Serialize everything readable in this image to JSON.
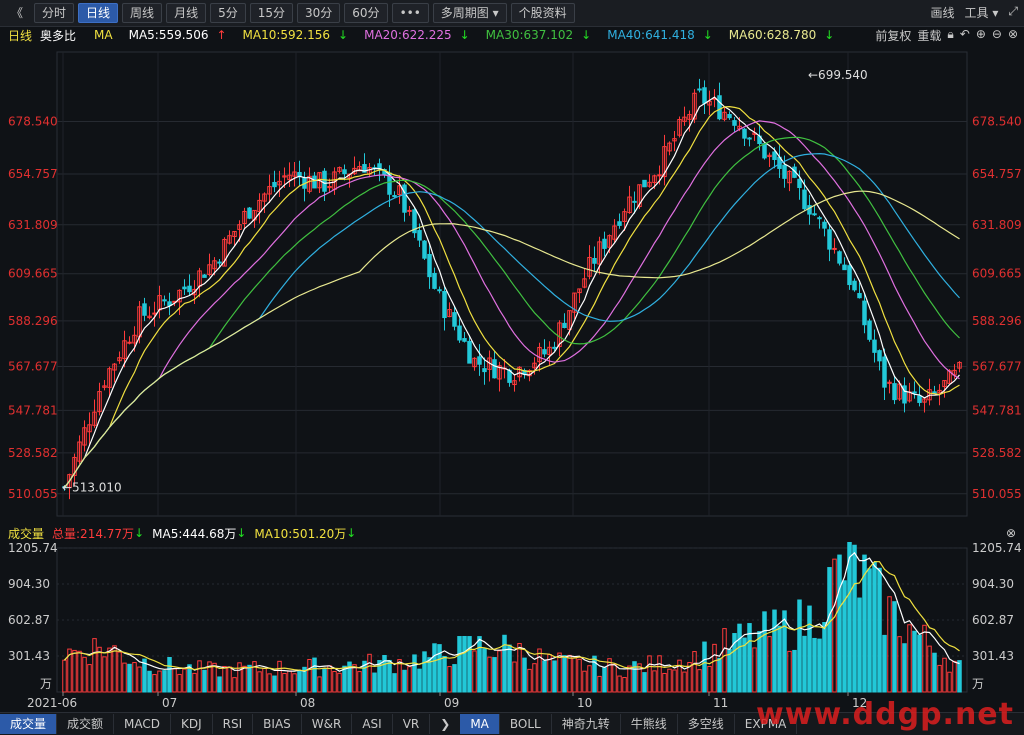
{
  "toolbar": {
    "back": "《",
    "periods": [
      "分时",
      "日线",
      "周线",
      "月线",
      "5分",
      "15分",
      "30分",
      "60分"
    ],
    "active": "日线",
    "more": "•••",
    "multi_period": "多周期图",
    "stock_info": "个股资料",
    "draw": "画线",
    "tools": "工具"
  },
  "info": {
    "period": "日线",
    "name": "奥多比",
    "ma_label": "MA",
    "ma": [
      {
        "label": "MA5:559.506",
        "arrow": "↑",
        "color": "#ffffff",
        "arrow_color": "#ff3b3b"
      },
      {
        "label": "MA10:592.156",
        "arrow": "↓",
        "color": "#f0e040",
        "arrow_color": "#22dd22"
      },
      {
        "label": "MA20:622.225",
        "arrow": "↓",
        "color": "#e070e0",
        "arrow_color": "#22dd22"
      },
      {
        "label": "MA30:637.102",
        "arrow": "↓",
        "color": "#40c040",
        "arrow_color": "#22dd22"
      },
      {
        "label": "MA40:641.418",
        "arrow": "↓",
        "color": "#30b0e0",
        "arrow_color": "#22dd22"
      },
      {
        "label": "MA60:628.780",
        "arrow": "↓",
        "color": "#e8e890",
        "arrow_color": "#22dd22"
      }
    ],
    "restore": "前复权",
    "overlay": "重载"
  },
  "price_axis": [
    "678.540",
    "654.757",
    "631.809",
    "609.665",
    "588.296",
    "567.677",
    "547.781",
    "528.582",
    "510.055"
  ],
  "price_range": [
    500,
    710
  ],
  "annotations": {
    "high": "699.540",
    "low": "513.010"
  },
  "volume": {
    "title": "成交量",
    "total": "总量:214.77万",
    "ma5": "MA5:444.68万",
    "ma10": "MA10:501.20万",
    "axis": [
      "1205.74",
      "904.30",
      "602.87",
      "301.43",
      "万"
    ]
  },
  "dates": [
    "2021-06",
    "07",
    "08",
    "09",
    "10",
    "11",
    "12"
  ],
  "tabs": [
    "成交量",
    "成交额",
    "MACD",
    "KDJ",
    "RSI",
    "BIAS",
    "W&R",
    "ASI",
    "VR",
    "MA",
    "BOLL",
    "神奇九转",
    "牛熊线",
    "多空线",
    "EXPMA"
  ],
  "active_tab": "MA",
  "watermark": "www.ddgp.net",
  "colors": {
    "up": "#ff3b3b",
    "down": "#22c8d8",
    "bg": "#0f1216"
  },
  "chart_data": {
    "type": "candlestick",
    "x": [
      "2021-06",
      "07",
      "08",
      "09",
      "10",
      "11",
      "12"
    ],
    "close_trend": [
      513,
      560,
      590,
      600,
      615,
      640,
      655,
      650,
      660,
      645,
      600,
      570,
      565,
      575,
      610,
      640,
      660,
      690,
      680,
      660,
      640,
      610,
      560,
      550,
      565
    ],
    "volume_trend": [
      320,
      380,
      260,
      200,
      180,
      190,
      200,
      210,
      230,
      250,
      300,
      380,
      360,
      250,
      220,
      200,
      230,
      300,
      420,
      500,
      600,
      1100,
      700,
      440,
      210
    ],
    "ylim": [
      500,
      710
    ],
    "vol_ylim": [
      0,
      1205.74
    ]
  }
}
